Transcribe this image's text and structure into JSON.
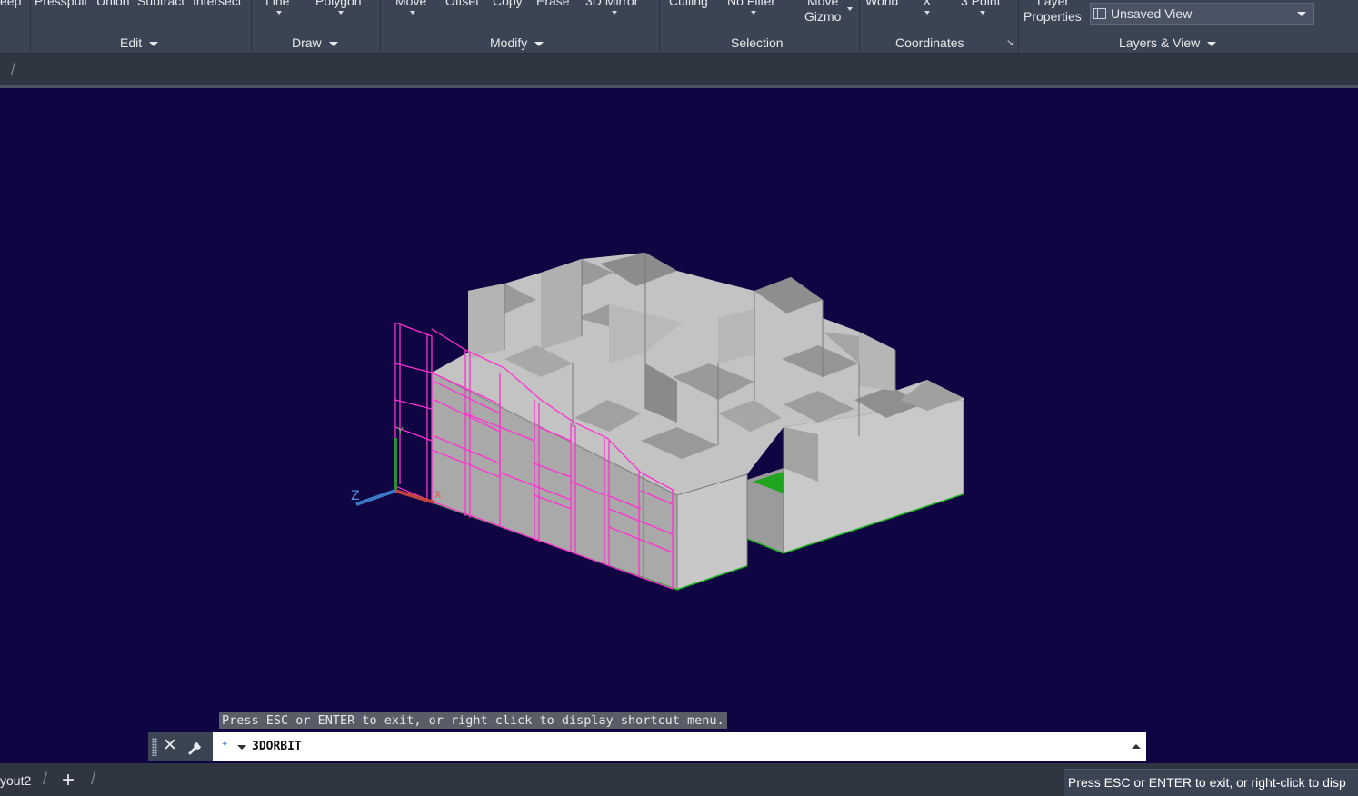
{
  "ribbon": {
    "edit_tools": [
      "eep",
      "Presspull",
      "Union",
      "Subtract",
      "Intersect"
    ],
    "draw_tools": [
      "Line",
      "Polygon"
    ],
    "modify_tools": [
      "Move",
      "Offset",
      "Copy",
      "Erase",
      "3D Mirror"
    ],
    "selection_tools": [
      "Culling",
      "No Filter",
      "Move",
      "Gizmo"
    ],
    "coordinate_tools": [
      "World",
      "X",
      "3 Point"
    ],
    "layer_tools": [
      "Layer",
      "Properties"
    ],
    "panels": {
      "edit": "Edit",
      "draw": "Draw",
      "modify": "Modify",
      "selection": "Selection",
      "coordinates": "Coordinates",
      "layers_view": "Layers & View"
    },
    "view_select": "Unsaved View"
  },
  "viewport": {
    "background": "#0f0542",
    "model_color": "#c8c8c8",
    "wireframe_color": "#ff2fd0",
    "ground_color": "#1fa81f"
  },
  "command": {
    "hint": "Press ESC or ENTER to exit, or right-click to display shortcut-menu.",
    "current": "3DORBIT"
  },
  "bottom": {
    "layout_tab": "yout2",
    "status_tip": "Press ESC or ENTER to exit, or right-click to disp"
  }
}
